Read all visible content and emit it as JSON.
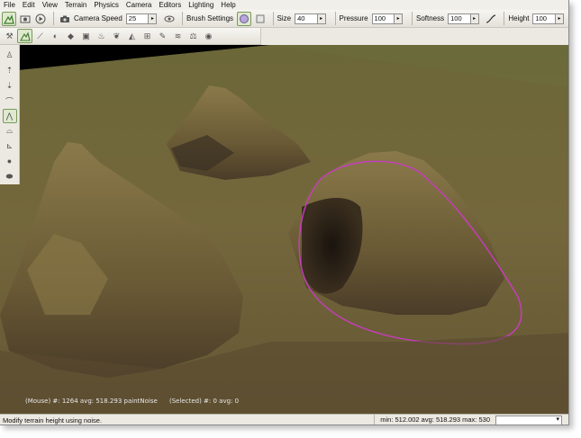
{
  "menu": [
    "File",
    "Edit",
    "View",
    "Terrain",
    "Physics",
    "Camera",
    "Editors",
    "Lighting",
    "Help"
  ],
  "toolbar": {
    "camera_speed_label": "Camera Speed",
    "camera_speed_value": "25",
    "brush_settings_label": "Brush Settings",
    "size_label": "Size",
    "size_value": "40",
    "pressure_label": "Pressure",
    "pressure_value": "100",
    "softness_label": "Softness",
    "softness_value": "100",
    "height_label": "Height",
    "height_value": "100"
  },
  "hud": {
    "mouse": "(Mouse) #: 1264  avg: 518.293  paintNoise",
    "selected": "(Selected) #: 0  avg: 0"
  },
  "status": {
    "message": "Modify terrain height using noise.",
    "stats": "min: 512.002  avg: 518.293  max: 530",
    "dropdown_value": ""
  },
  "colors": {
    "brush_ring": "#c83cc0",
    "sky": "#000000"
  }
}
